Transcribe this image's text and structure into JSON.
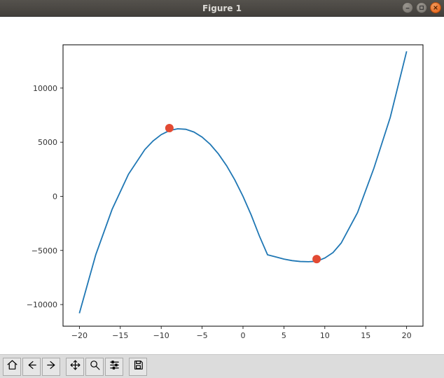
{
  "window": {
    "title": "Figure 1"
  },
  "toolbar": [
    {
      "name": "home-icon"
    },
    {
      "name": "back-icon"
    },
    {
      "name": "forward-icon"
    },
    {
      "sep": true
    },
    {
      "name": "pan-icon"
    },
    {
      "name": "zoom-icon"
    },
    {
      "name": "configure-icon"
    },
    {
      "sep": true
    },
    {
      "name": "save-icon"
    }
  ],
  "chart_data": {
    "type": "line",
    "title": "",
    "xlabel": "",
    "ylabel": "",
    "xlim": [
      -22,
      22
    ],
    "ylim": [
      -12000,
      14000
    ],
    "xticks": [
      -20,
      -15,
      -10,
      -5,
      0,
      5,
      10,
      15,
      20
    ],
    "yticks": [
      -10000,
      -5000,
      0,
      5000,
      10000
    ],
    "grid": false,
    "legend": false,
    "series": [
      {
        "name": "curve",
        "color": "#1f77b4",
        "x": [
          -20,
          -18,
          -16,
          -14,
          -12,
          -11,
          -10,
          -9,
          -8,
          -7,
          -6,
          -5,
          -4,
          -3,
          -2,
          -1,
          0,
          1,
          2,
          3,
          4,
          5,
          6,
          7,
          8,
          9,
          10,
          11,
          12,
          14,
          16,
          18,
          20
        ],
        "y": [
          -10800,
          -5400,
          -1200,
          2040,
          4320,
          5115,
          5700,
          6075,
          6240,
          6195,
          5940,
          5475,
          4800,
          3915,
          2820,
          1515,
          0,
          -1725,
          -3660,
          -5400,
          -5600,
          -5800,
          -5940,
          -6020,
          -6040,
          -6000,
          -5700,
          -5200,
          -4320,
          -1500,
          2600,
          7300,
          13400
        ]
      }
    ],
    "markers": [
      {
        "x": -9,
        "y": 6300,
        "color": "#e24a33",
        "radius_px": 6
      },
      {
        "x": 9,
        "y": -5800,
        "color": "#e24a33",
        "radius_px": 6
      }
    ]
  }
}
